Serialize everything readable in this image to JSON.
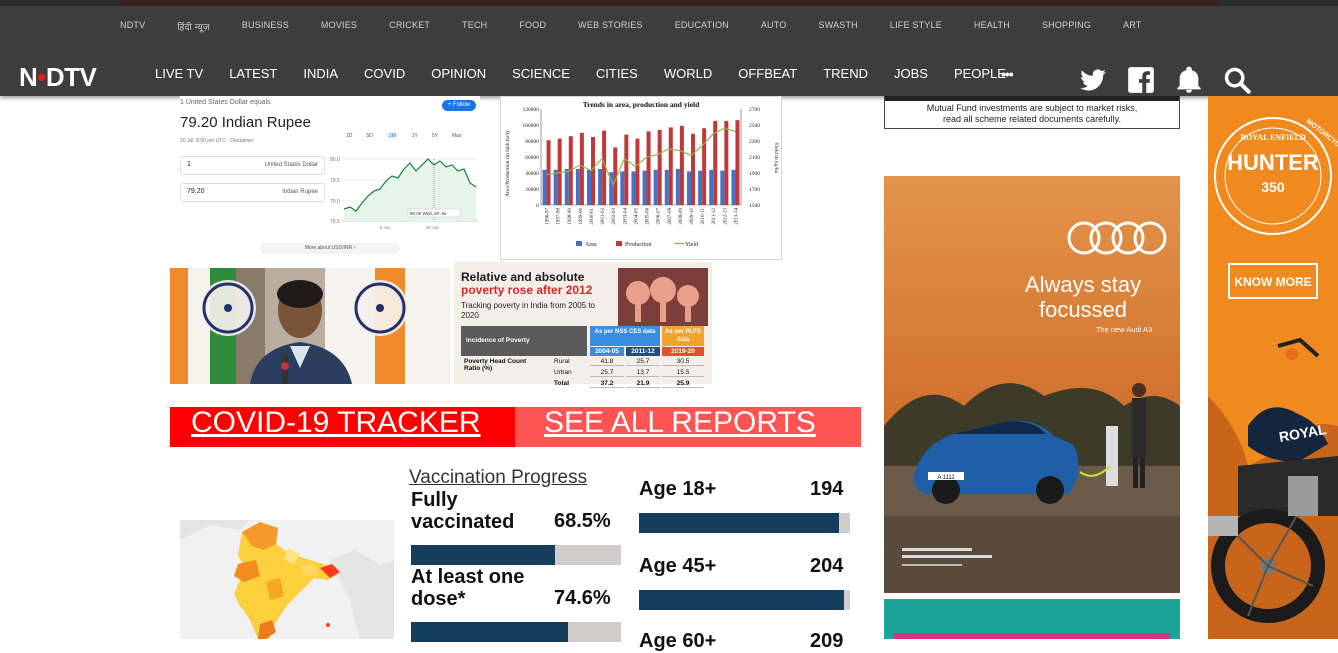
{
  "header": {
    "logo": "NDTV",
    "subnav": [
      "NDTV",
      "हिंदी न्यूज़",
      "BUSINESS",
      "MOVIES",
      "CRICKET",
      "TECH",
      "FOOD",
      "WEB STORIES",
      "EDUCATION",
      "AUTO",
      "SWASTH",
      "LIFE STYLE",
      "HEALTH",
      "SHOPPING",
      "ART"
    ],
    "mainnav": [
      "LIVE TV",
      "LATEST",
      "INDIA",
      "COVID",
      "OPINION",
      "SCIENCE",
      "CITIES",
      "WORLD",
      "OFFBEAT",
      "TREND",
      "JOBS",
      "PEOPLE"
    ],
    "more_label": "•••",
    "icons": [
      "twitter-icon",
      "facebook-icon",
      "bell-icon",
      "search-icon"
    ]
  },
  "currency_widget": {
    "equals_text": "1 United States Dollar equals",
    "result": "79.20 Indian Rupee",
    "date_text": "20 Jul, 8:00 pm UTC · Disclaimer",
    "follow_label": "+ Follow",
    "from_value": "1",
    "from_unit": "United States Dollar",
    "to_value": "79.20",
    "to_unit": "Indian Rupee",
    "ranges": [
      "1D",
      "5D",
      "1M",
      "1Y",
      "5Y",
      "Max"
    ],
    "selected_range": "1M",
    "y_ticks": [
      "80.0",
      "79.5",
      "79.0",
      "78.5"
    ],
    "x_ticks": [
      "5 Jul",
      "20 Jul"
    ],
    "tooltip": "80.00  Wed, 20 Jul",
    "more_link": "More about USD/INR"
  },
  "trend_chart": {
    "title": "Trends in area, production and yield",
    "left_axis_label": "Area/Production (in lakh ha/t)",
    "right_axis_label": "Yield in kg/ha",
    "left_ticks": [
      "120000",
      "100000",
      "80000",
      "60000",
      "40000",
      "20000",
      "0"
    ],
    "right_ticks": [
      "2700",
      "2500",
      "2300",
      "2100",
      "1900",
      "1700",
      "1500"
    ],
    "years": [
      "1996-97",
      "1997-98",
      "1998-99",
      "1999-00",
      "2000-01",
      "2001-02",
      "2002-03",
      "2003-04",
      "2004-05",
      "2005-06",
      "2006-07",
      "2007-08",
      "2008-09",
      "2009-10",
      "2010-11",
      "2011-12",
      "2012-13",
      "2013-14"
    ],
    "area": [
      44,
      44,
      45,
      45,
      44,
      45,
      41,
      42,
      42,
      43,
      44,
      44,
      45,
      42,
      43,
      44,
      43,
      44
    ],
    "production": [
      81,
      83,
      86,
      90,
      85,
      93,
      72,
      88,
      83,
      92,
      94,
      97,
      99,
      89,
      96,
      105,
      105,
      106
    ],
    "yield": [
      1880,
      1900,
      1920,
      2000,
      1930,
      2080,
      1750,
      2080,
      1980,
      2100,
      2130,
      2200,
      2180,
      2120,
      2240,
      2390,
      2460,
      2420
    ],
    "legend": [
      "Area",
      "Production",
      "Yield"
    ],
    "colors": {
      "area": "#4472c4",
      "production": "#c0383a",
      "yield": "#8cb84a"
    }
  },
  "poverty_card": {
    "heading": "Relative and absolute",
    "heading2": "poverty rose after 2012",
    "subheading": "Tracking poverty in India from 2005 to 2020",
    "table_header": [
      "Incidence of Poverty",
      "As per NSS CES data",
      "As per PLFS data"
    ],
    "years": [
      "2004-05",
      "2011-12",
      "2019-20"
    ],
    "row_label": "Poverty Head Count Ratio (%)",
    "rows": [
      {
        "name": "Rural",
        "values": [
          "41.8",
          "25.7",
          "30.5"
        ]
      },
      {
        "name": "Urban",
        "values": [
          "25.7",
          "13.7",
          "15.5"
        ]
      },
      {
        "name": "Total",
        "values": [
          "37.2",
          "21.9",
          "25.9"
        ]
      }
    ]
  },
  "tracker": {
    "left_label": "COVID-19 TRACKER",
    "right_label": "SEE ALL REPORTS"
  },
  "vaccination": {
    "title": "Vaccination Progress",
    "stats": [
      {
        "label_line1": "Fully",
        "label_line2": "vaccinated",
        "value": "68.5%",
        "fraction": 0.685
      },
      {
        "label_line1": "At least one",
        "label_line2": "dose*",
        "value": "74.6%",
        "fraction": 0.746
      }
    ],
    "ages": [
      {
        "label": "Age 18+",
        "value": "194",
        "fraction": 0.95
      },
      {
        "label": "Age 45+",
        "value": "204",
        "fraction": 0.97
      },
      {
        "label": "Age 60+",
        "value": "209",
        "fraction": 0.98
      }
    ]
  },
  "ads": {
    "mf_notice_line1": "Mutual Fund investments are subject to market risks,",
    "mf_notice_line2": "read all scheme related documents carefully.",
    "audi_headline1": "Always stay",
    "audi_headline2": "focussed",
    "audi_tagline": "The new Audi A3",
    "audi_plate": "A 1111",
    "re_brand": "ROYAL ENFIELD",
    "re_model": "HUNTER",
    "re_number": "350",
    "re_cta": "KNOW MORE",
    "re_arc": "MOTORCYCLING",
    "re_tank": "ROYAL"
  }
}
